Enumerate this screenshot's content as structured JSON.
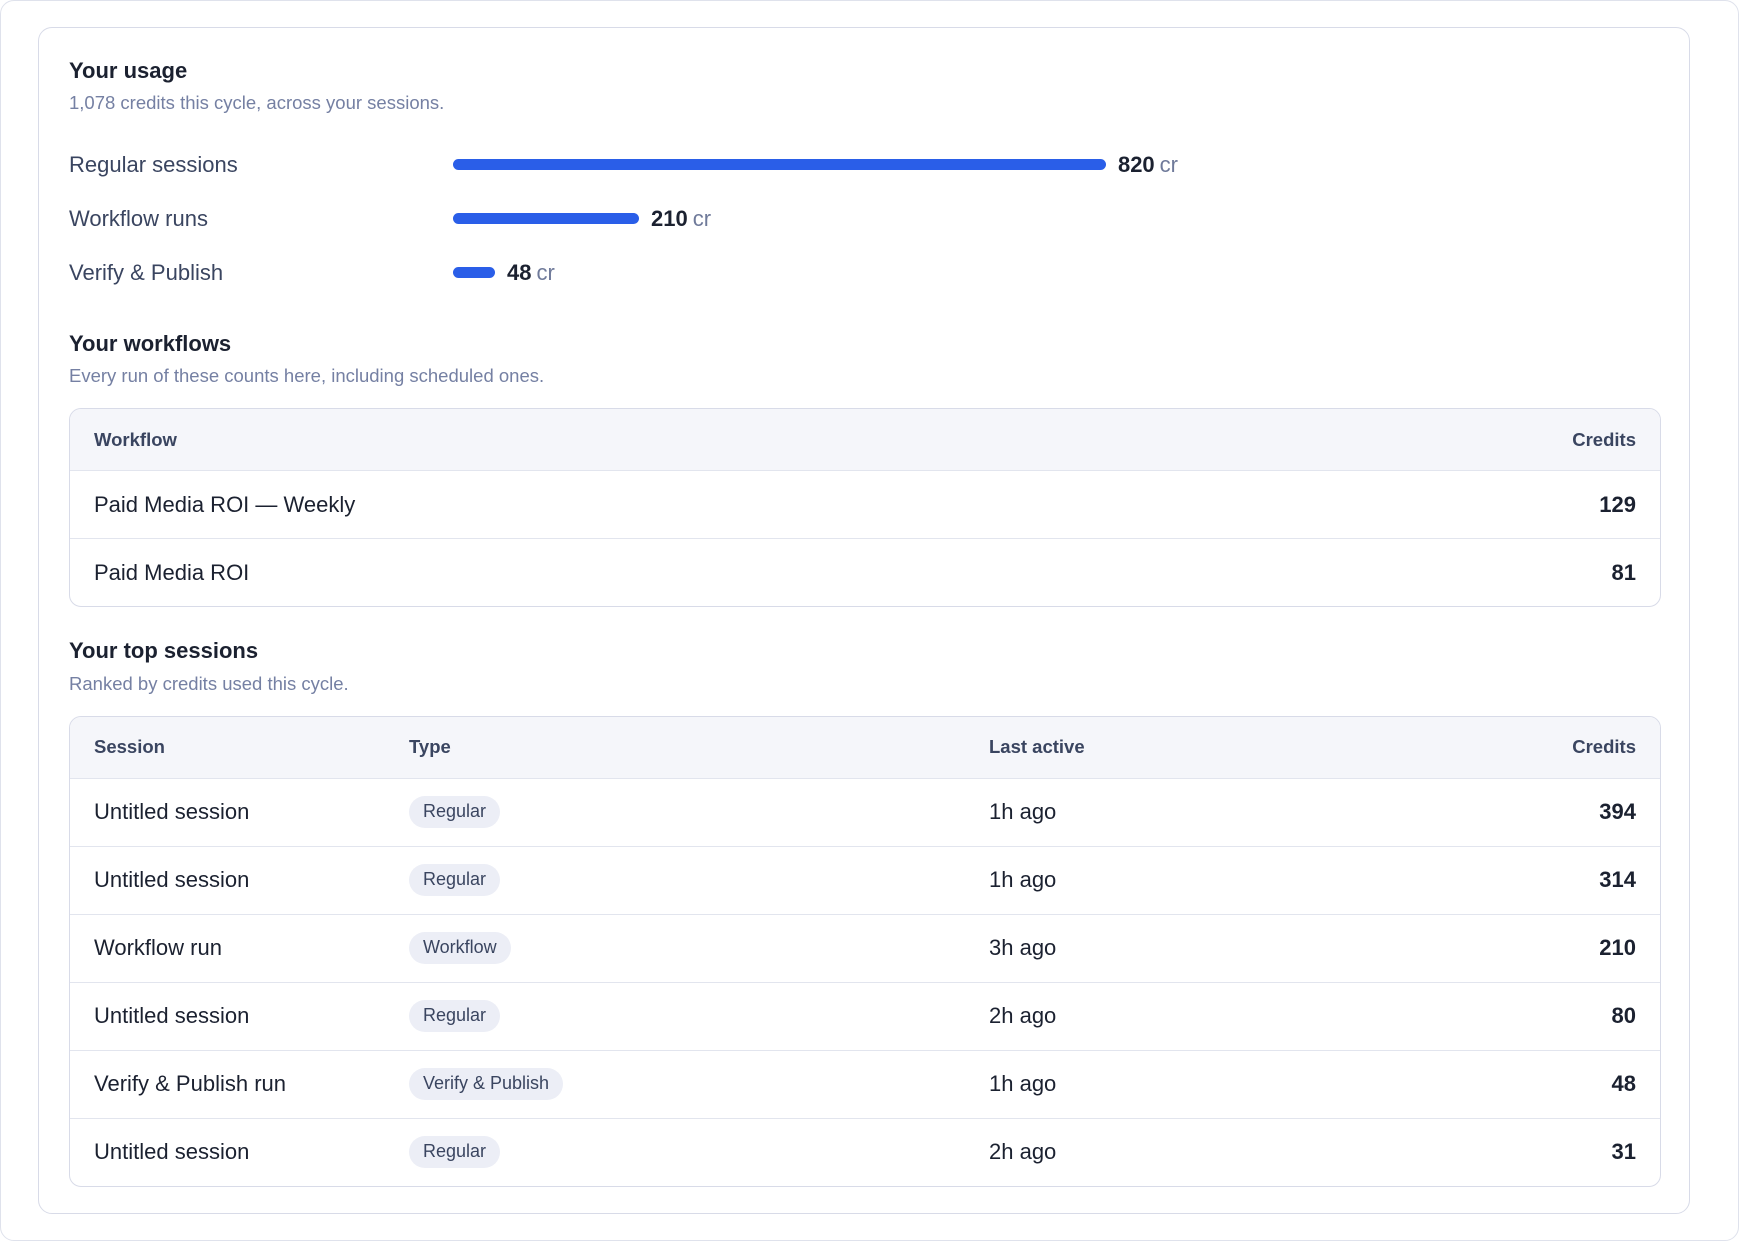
{
  "usage": {
    "title": "Your usage",
    "subtitle": "1,078 credits this cycle, across your sessions.",
    "unit": "cr",
    "rows": [
      {
        "label": "Regular sessions",
        "value": 820
      },
      {
        "label": "Workflow runs",
        "value": 210
      },
      {
        "label": "Verify & Publish",
        "value": 48
      }
    ]
  },
  "workflows": {
    "title": "Your workflows",
    "subtitle": "Every run of these counts here, including scheduled ones.",
    "columns": {
      "workflow": "Workflow",
      "credits": "Credits"
    },
    "rows": [
      {
        "name": "Paid Media ROI — Weekly",
        "credits": "129"
      },
      {
        "name": "Paid Media ROI",
        "credits": "81"
      }
    ]
  },
  "sessions": {
    "title": "Your top sessions",
    "subtitle": "Ranked by credits used this cycle.",
    "columns": {
      "session": "Session",
      "type": "Type",
      "last_active": "Last active",
      "credits": "Credits"
    },
    "rows": [
      {
        "session": "Untitled session",
        "type": "Regular",
        "last_active": "1h ago",
        "credits": "394"
      },
      {
        "session": "Untitled session",
        "type": "Regular",
        "last_active": "1h ago",
        "credits": "314"
      },
      {
        "session": "Workflow run",
        "type": "Workflow",
        "last_active": "3h ago",
        "credits": "210"
      },
      {
        "session": "Untitled session",
        "type": "Regular",
        "last_active": "2h ago",
        "credits": "80"
      },
      {
        "session": "Verify & Publish run",
        "type": "Verify & Publish",
        "last_active": "1h ago",
        "credits": "48"
      },
      {
        "session": "Untitled session",
        "type": "Regular",
        "last_active": "2h ago",
        "credits": "31"
      }
    ]
  },
  "colors": {
    "bar": "#2a5ee8",
    "pill_bg": "#eceef6",
    "muted_text": "#7580a3"
  }
}
